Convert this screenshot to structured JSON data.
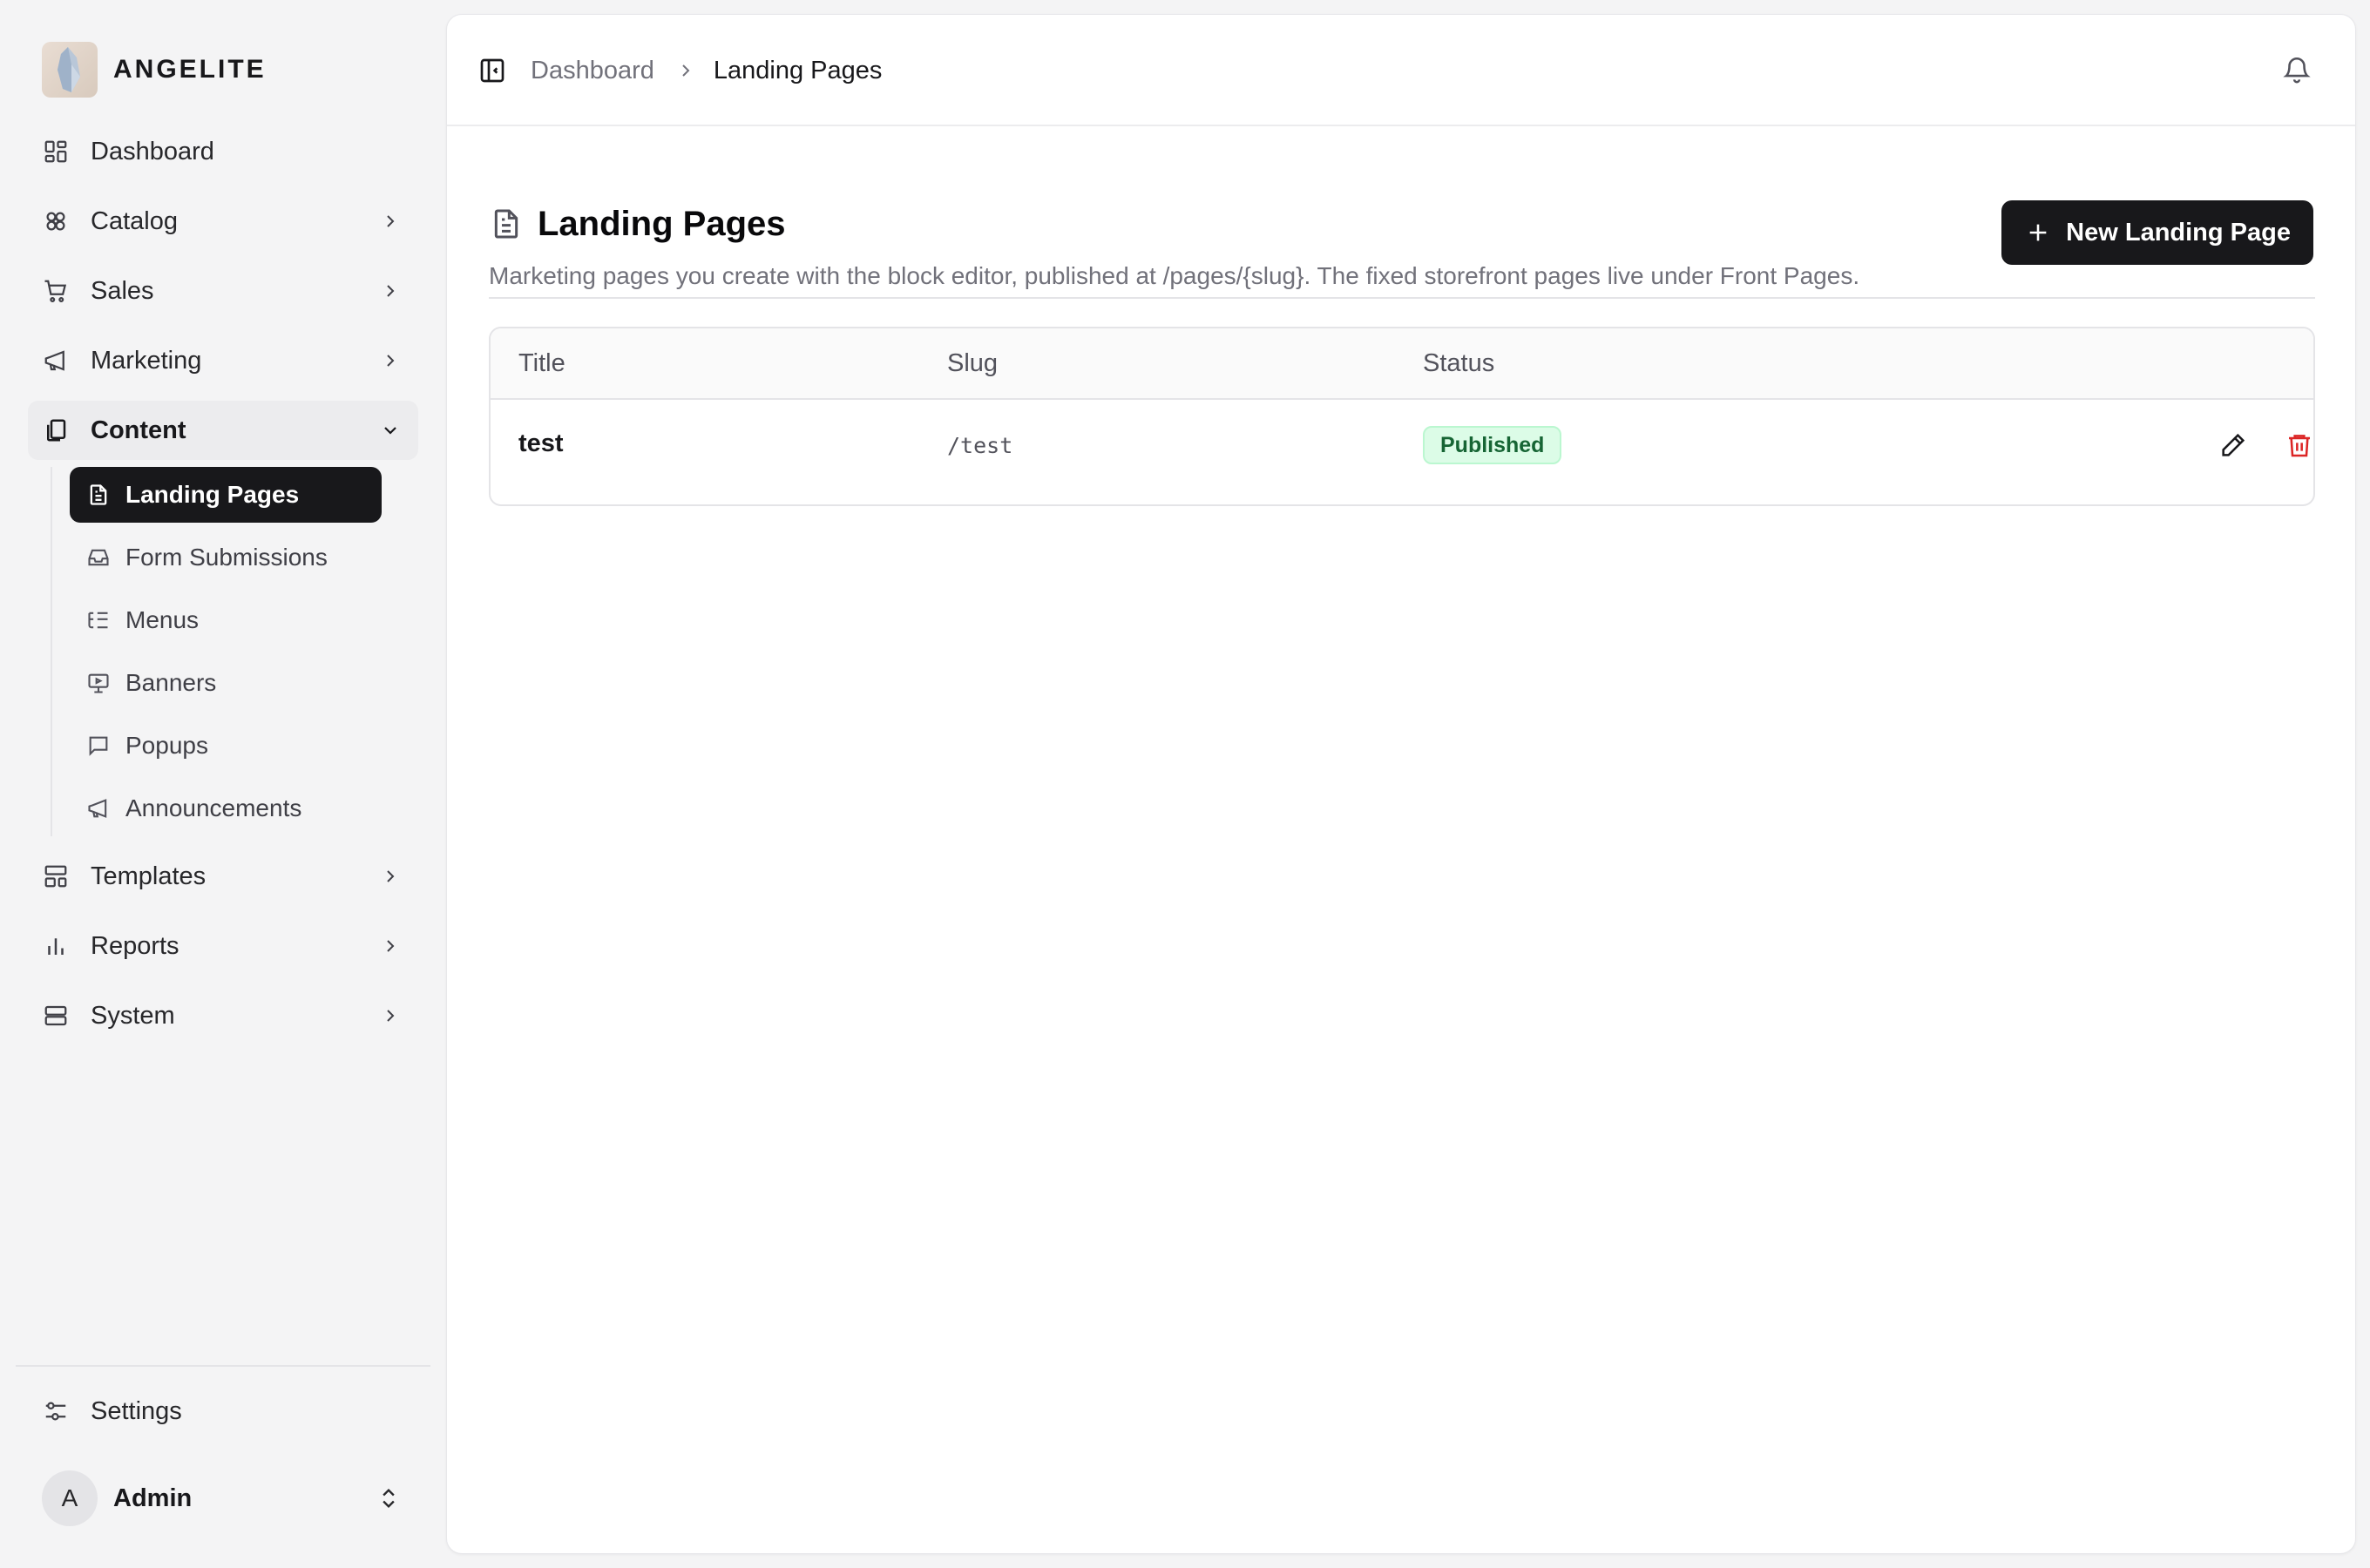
{
  "brand": {
    "name": "ANGELITE"
  },
  "sidebar": {
    "items": [
      {
        "label": "Dashboard",
        "icon": "dashboard-icon"
      },
      {
        "label": "Catalog",
        "icon": "catalog-icon"
      },
      {
        "label": "Sales",
        "icon": "cart-icon"
      },
      {
        "label": "Marketing",
        "icon": "megaphone-icon"
      },
      {
        "label": "Content",
        "icon": "content-icon"
      },
      {
        "label": "Templates",
        "icon": "templates-icon"
      },
      {
        "label": "Reports",
        "icon": "bar-chart-icon"
      },
      {
        "label": "System",
        "icon": "server-icon"
      }
    ],
    "content_children": [
      {
        "label": "Landing Pages",
        "icon": "file-text-icon"
      },
      {
        "label": "Form Submissions",
        "icon": "inbox-icon"
      },
      {
        "label": "Menus",
        "icon": "list-tree-icon"
      },
      {
        "label": "Banners",
        "icon": "presentation-icon"
      },
      {
        "label": "Popups",
        "icon": "message-square-icon"
      },
      {
        "label": "Announcements",
        "icon": "megaphone-icon"
      }
    ],
    "settings": {
      "label": "Settings",
      "icon": "sliders-icon"
    },
    "user": {
      "initial": "A",
      "name": "Admin"
    }
  },
  "topbar": {
    "breadcrumb": [
      "Dashboard",
      "Landing Pages"
    ]
  },
  "page": {
    "title": "Landing Pages",
    "description": "Marketing pages you create with the block editor, published at /pages/{slug}. The fixed storefront pages live under Front Pages.",
    "new_button": "New Landing Page"
  },
  "table": {
    "columns": [
      "Title",
      "Slug",
      "Status"
    ],
    "rows": [
      {
        "title": "test",
        "slug": "/test",
        "status": "Published"
      }
    ]
  },
  "colors": {
    "accent": "#18181b",
    "badge_bg": "#dcfce7",
    "badge_text": "#166534",
    "danger": "#dc2626"
  }
}
